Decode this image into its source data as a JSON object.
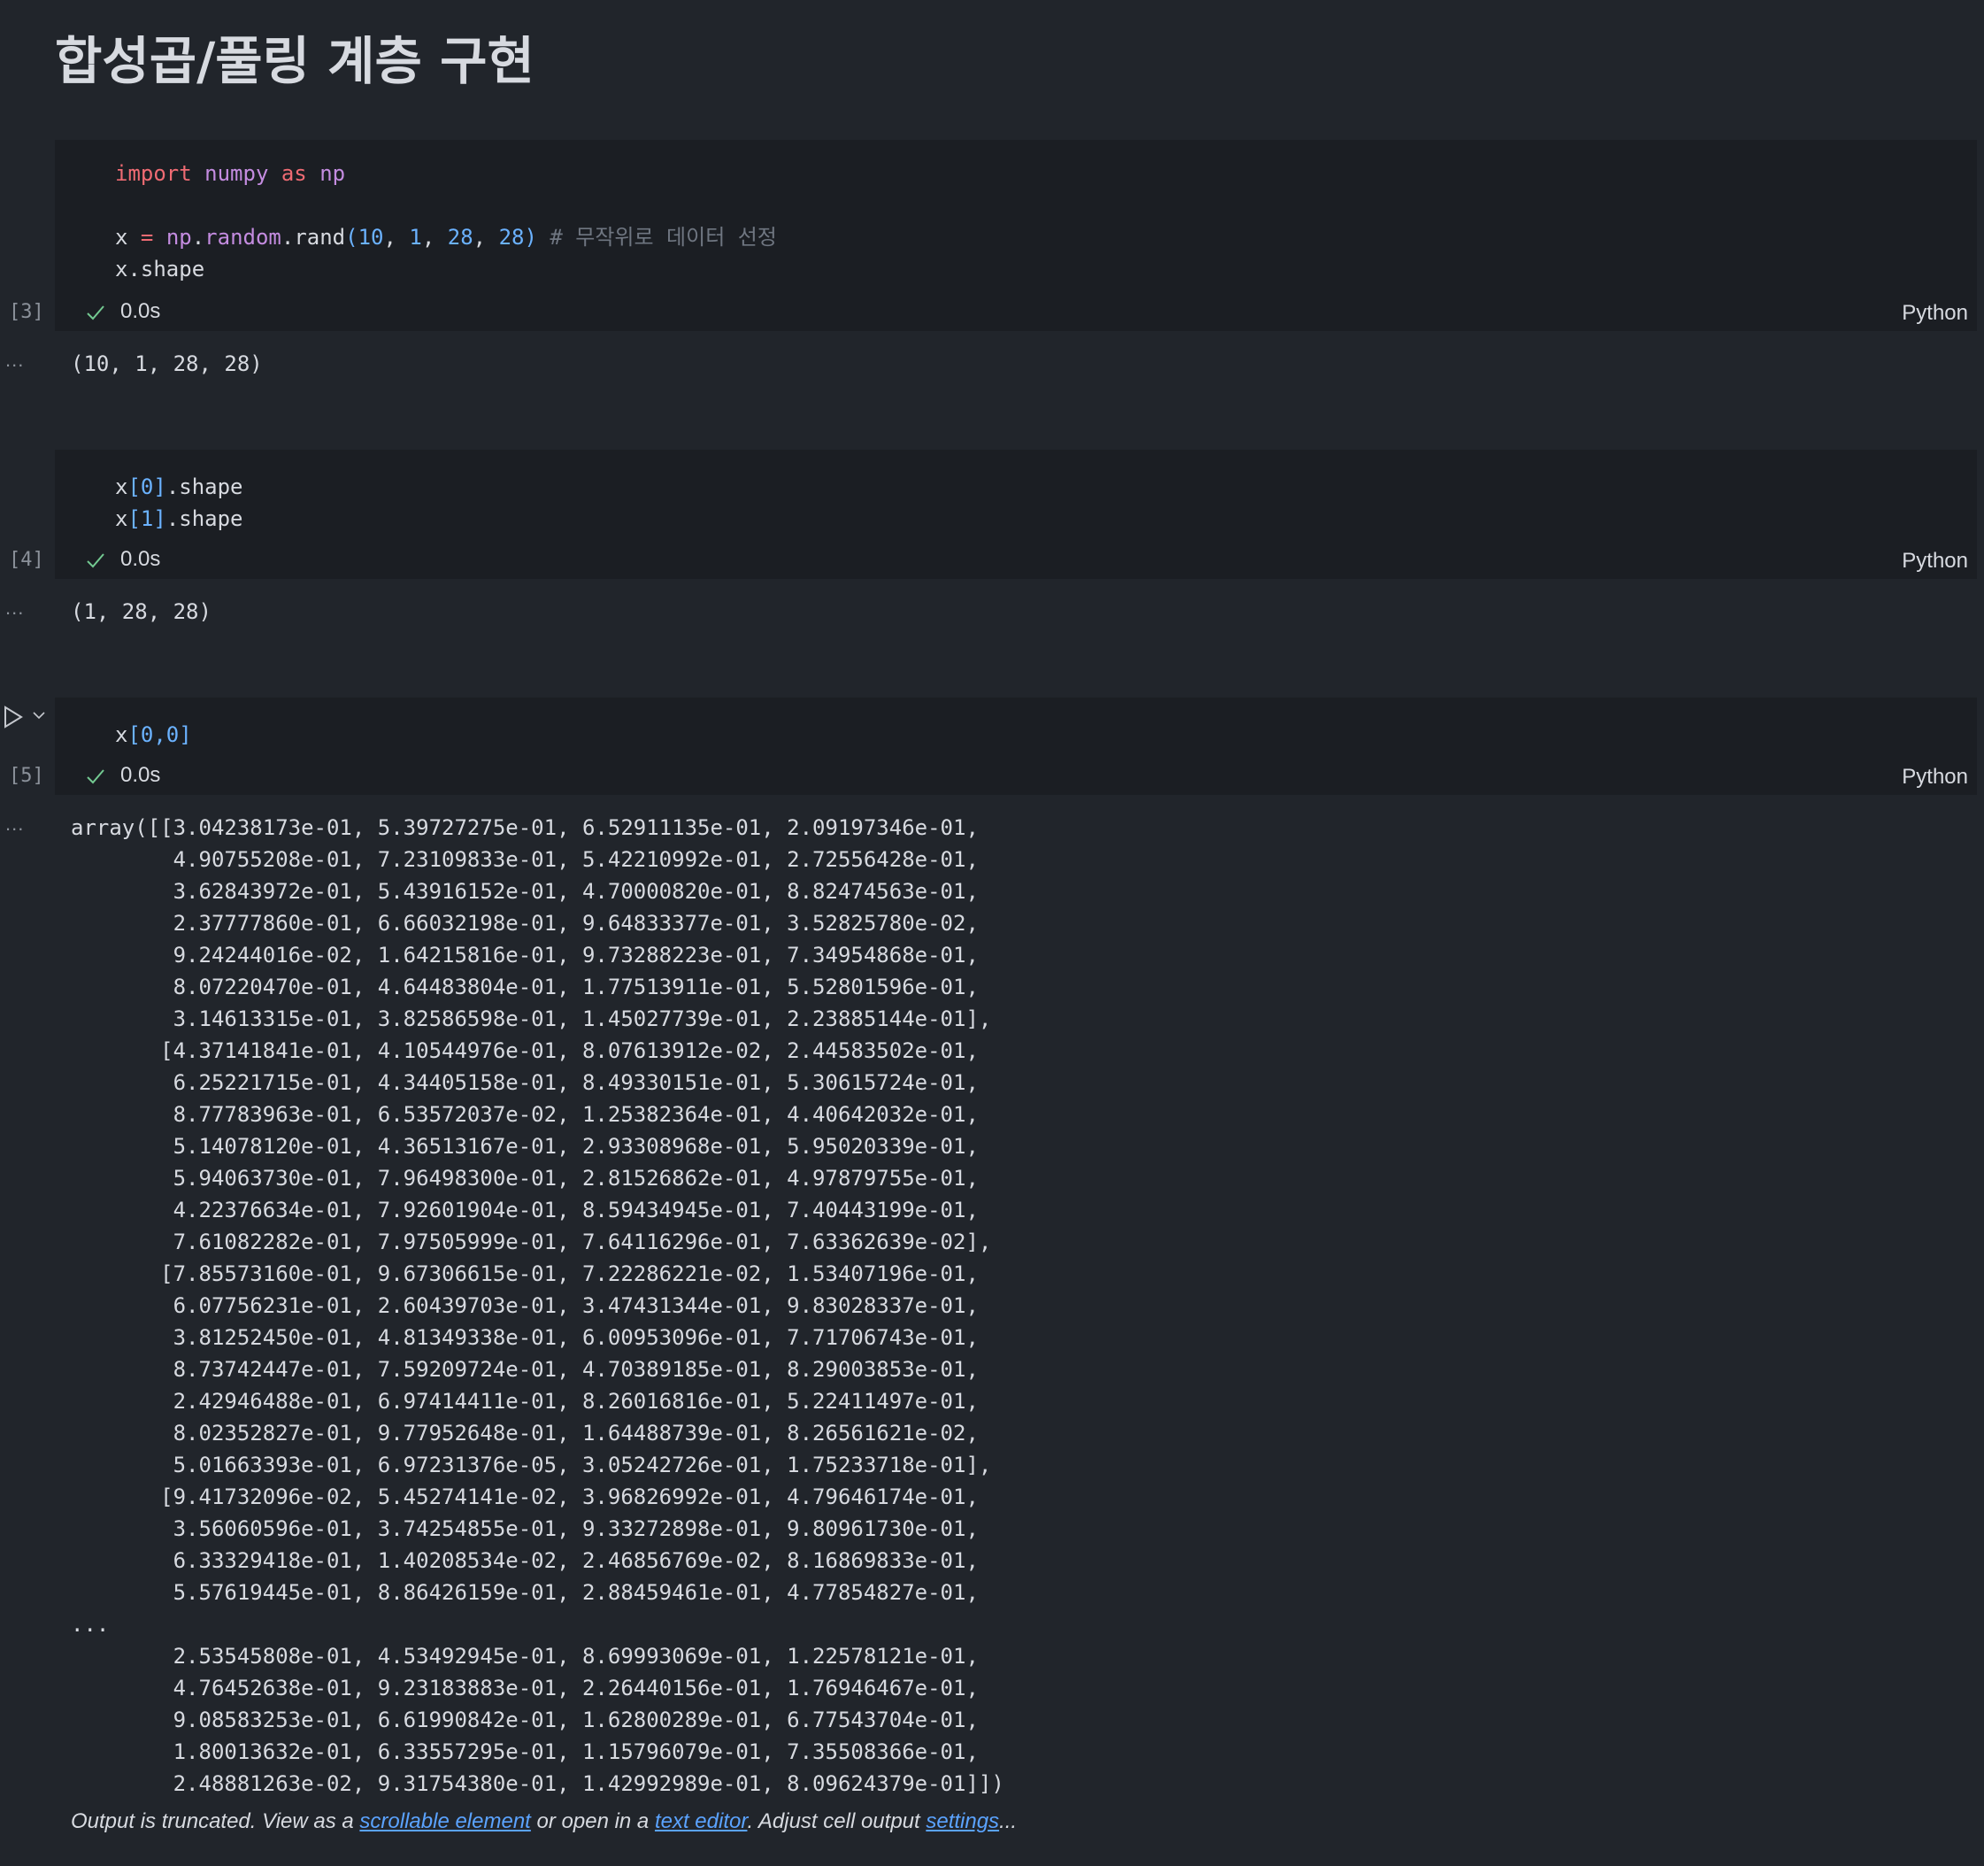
{
  "heading": "합성곱/풀링 계층 구현",
  "cells": [
    {
      "exec_count": "[3]",
      "duration": "0.0s",
      "language": "Python",
      "output": "(10, 1, 28, 28)"
    },
    {
      "exec_count": "[4]",
      "duration": "0.0s",
      "language": "Python",
      "output": "(1, 28, 28)"
    },
    {
      "exec_count": "[5]",
      "duration": "0.0s",
      "language": "Python"
    }
  ],
  "code": {
    "c1": {
      "import_kw": "import",
      "numpy": "numpy",
      "as_kw": "as",
      "np": "np",
      "l2_x": "x",
      "l2_eq": "=",
      "l2_np": "np",
      "l2_random": "random",
      "l2_rand": "rand",
      "l2_n10": "10",
      "l2_n1": "1",
      "l2_n28a": "28",
      "l2_n28b": "28",
      "l2_comment": "# 무작위로 데이터 선정",
      "l3": "x.shape"
    },
    "c2": {
      "l1_x": "x",
      "l1_idx": "[0]",
      "l1_rest": ".shape",
      "l2_x": "x",
      "l2_idx": "[1]",
      "l2_rest": ".shape"
    },
    "c3": {
      "l1_x": "x",
      "l1_idx": "[0,0]"
    }
  },
  "array_output": [
    "array([[3.04238173e-01, 5.39727275e-01, 6.52911135e-01, 2.09197346e-01,",
    "        4.90755208e-01, 7.23109833e-01, 5.42210992e-01, 2.72556428e-01,",
    "        3.62843972e-01, 5.43916152e-01, 4.70000820e-01, 8.82474563e-01,",
    "        2.37777860e-01, 6.66032198e-01, 9.64833377e-01, 3.52825780e-02,",
    "        9.24244016e-02, 1.64215816e-01, 9.73288223e-01, 7.34954868e-01,",
    "        8.07220470e-01, 4.64483804e-01, 1.77513911e-01, 5.52801596e-01,",
    "        3.14613315e-01, 3.82586598e-01, 1.45027739e-01, 2.23885144e-01],",
    "       [4.37141841e-01, 4.10544976e-01, 8.07613912e-02, 2.44583502e-01,",
    "        6.25221715e-01, 4.34405158e-01, 8.49330151e-01, 5.30615724e-01,",
    "        8.77783963e-01, 6.53572037e-02, 1.25382364e-01, 4.40642032e-01,",
    "        5.14078120e-01, 4.36513167e-01, 2.93308968e-01, 5.95020339e-01,",
    "        5.94063730e-01, 7.96498300e-01, 2.81526862e-01, 4.97879755e-01,",
    "        4.22376634e-01, 7.92601904e-01, 8.59434945e-01, 7.40443199e-01,",
    "        7.61082282e-01, 7.97505999e-01, 7.64116296e-01, 7.63362639e-02],",
    "       [7.85573160e-01, 9.67306615e-01, 7.22286221e-02, 1.53407196e-01,",
    "        6.07756231e-01, 2.60439703e-01, 3.47431344e-01, 9.83028337e-01,",
    "        3.81252450e-01, 4.81349338e-01, 6.00953096e-01, 7.71706743e-01,",
    "        8.73742447e-01, 7.59209724e-01, 4.70389185e-01, 8.29003853e-01,",
    "        2.42946488e-01, 6.97414411e-01, 8.26016816e-01, 5.22411497e-01,",
    "        8.02352827e-01, 9.77952648e-01, 1.64488739e-01, 8.26561621e-02,",
    "        5.01663393e-01, 6.97231376e-05, 3.05242726e-01, 1.75233718e-01],",
    "       [9.41732096e-02, 5.45274141e-02, 3.96826992e-01, 4.79646174e-01,",
    "        3.56060596e-01, 3.74254855e-01, 9.33272898e-01, 9.80961730e-01,",
    "        6.33329418e-01, 1.40208534e-02, 2.46856769e-02, 8.16869833e-01,",
    "        5.57619445e-01, 8.86426159e-01, 2.88459461e-01, 4.77854827e-01,",
    "...",
    "        2.53545808e-01, 4.53492945e-01, 8.69993069e-01, 1.22578121e-01,",
    "        4.76452638e-01, 9.23183883e-01, 2.26440156e-01, 1.76946467e-01,",
    "        9.08583253e-01, 6.61990842e-01, 1.62800289e-01, 6.77543704e-01,",
    "        1.80013632e-01, 6.33557295e-01, 1.15796079e-01, 7.35508366e-01,",
    "        2.48881263e-02, 9.31754380e-01, 1.42992989e-01, 8.09624379e-01]])"
  ],
  "truncation": {
    "prefix": "Output is truncated. View as a ",
    "scrollable_link": "scrollable element",
    "middle": " or open in a ",
    "editor_link": "text editor",
    "after_editor": ". Adjust cell output ",
    "settings_link": "settings",
    "suffix": "..."
  },
  "output_marker": "...",
  "colors": {
    "background": "#21252b",
    "cell": "#1b1e23",
    "keyword": "#ef6b73",
    "module": "#c48ce0",
    "number": "#6bb2ff",
    "link": "#5ba3ff",
    "check": "#73c991"
  }
}
